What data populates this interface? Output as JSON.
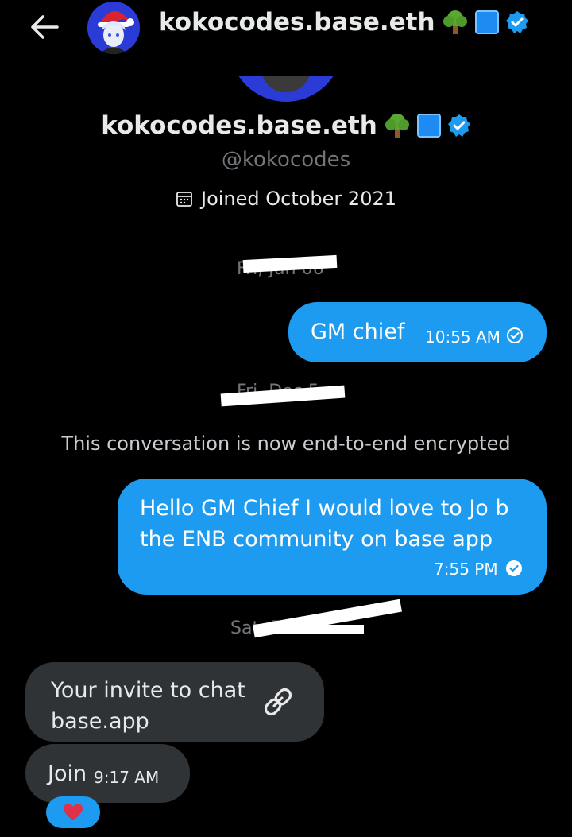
{
  "header": {
    "back_label": "←",
    "title": "kokocodes.base.eth"
  },
  "profile": {
    "display_name": "kokocodes.base.eth",
    "handle": "@kokocodes",
    "joined": "Joined October 2021",
    "badges": [
      "tree-emoji",
      "blue-square-emoji",
      "verified-badge"
    ]
  },
  "conversation": {
    "date_1": "Fri, Jun 06",
    "msg_1": {
      "text": "GM chief",
      "time": "10:55 AM"
    },
    "date_2": "Fri, Dec 5",
    "system_notice": "This conversation is now end-to-end encrypted",
    "msg_2": {
      "line1": "Hello GM Chief I would love to Jo b",
      "line2": "the ENB community on base app",
      "time": "7:55 PM"
    },
    "date_3": "Sat, Dec 6",
    "invite": {
      "title": "Your invite to chat",
      "subtitle": "base.app"
    },
    "join_msg": {
      "text": "Join",
      "time": "9:17 AM"
    },
    "reaction": "heart-emoji"
  },
  "colors": {
    "background": "#000000",
    "outgoing_bubble": "#1d9bf0",
    "incoming_bubble": "#2f3336",
    "muted_text": "#71767b"
  }
}
